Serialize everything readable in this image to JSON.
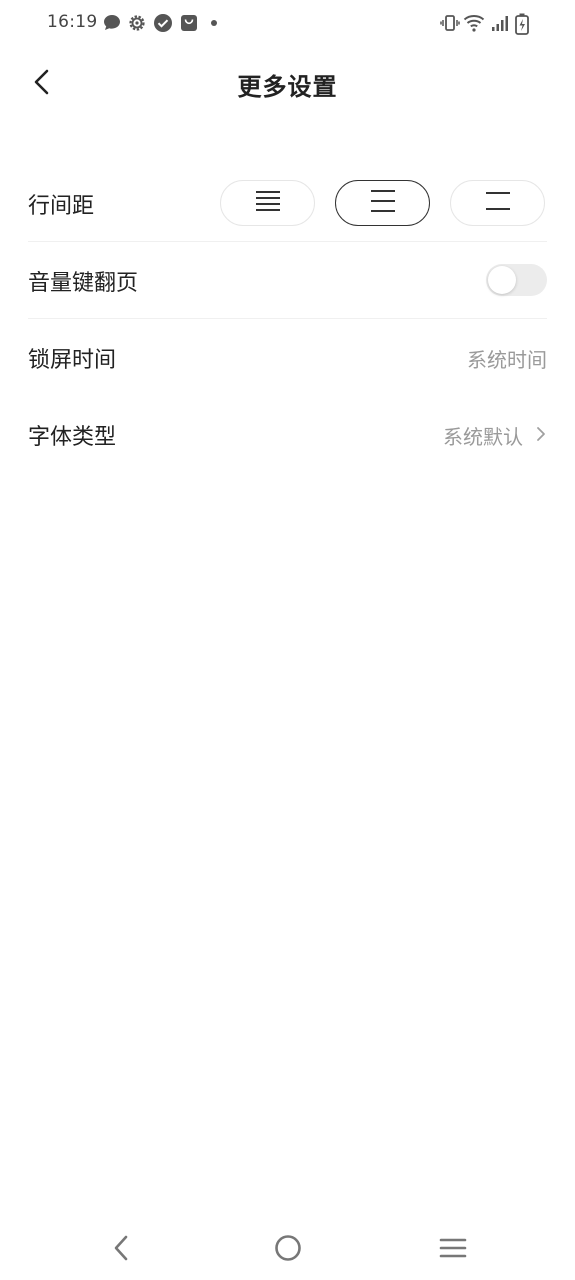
{
  "status_bar": {
    "time": "16:19",
    "left_icons": [
      "message-icon",
      "gear-icon",
      "check-circle-icon",
      "bag-icon",
      "dot-icon"
    ],
    "right_icons": [
      "vibrate-icon",
      "wifi-icon",
      "signal-icon",
      "battery-charging-icon"
    ]
  },
  "header": {
    "title": "更多设置",
    "back_icon": "chevron-left-icon"
  },
  "settings": {
    "line_spacing": {
      "label": "行间距",
      "options": [
        "compact",
        "medium",
        "loose"
      ],
      "selected": "medium"
    },
    "volume_key_paging": {
      "label": "音量键翻页",
      "enabled": false
    },
    "lock_screen_time": {
      "label": "锁屏时间",
      "value": "系统时间"
    },
    "font_type": {
      "label": "字体类型",
      "value": "系统默认",
      "chevron_icon": "chevron-right-icon"
    }
  },
  "nav_bar": {
    "buttons": [
      "back-icon",
      "home-icon",
      "menu-icon"
    ]
  },
  "colors": {
    "text_primary": "#222222",
    "text_secondary": "#9a9a9a",
    "toggle_off": "#ececec",
    "divider": "#f0f0f0",
    "selected_border": "#333333"
  }
}
